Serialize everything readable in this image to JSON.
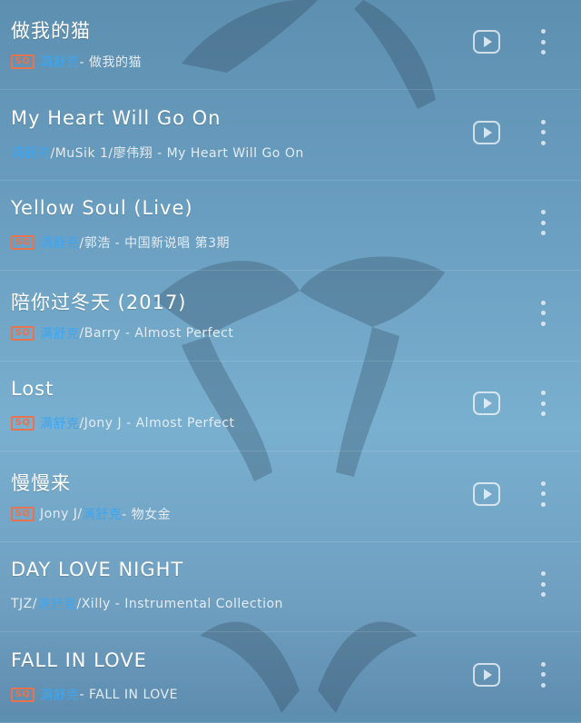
{
  "songs": [
    {
      "title": "做我的猫",
      "sq": true,
      "meta_prefix": "",
      "artist_hl": "满舒克",
      "meta_suffix": " - 做我的猫",
      "has_play": true
    },
    {
      "title": "My Heart Will Go On",
      "sq": false,
      "meta_prefix": "",
      "artist_hl": "满舒克",
      "meta_suffix": "/MuSik 1/廖伟翔 - My Heart Will Go On",
      "has_play": true
    },
    {
      "title": "Yellow Soul (Live)",
      "sq": true,
      "meta_prefix": "",
      "artist_hl": "满舒克",
      "meta_suffix": "/郭浩 - 中国新说唱 第3期",
      "has_play": false
    },
    {
      "title": "陪你过冬天 (2017)",
      "sq": true,
      "meta_prefix": "",
      "artist_hl": "满舒克",
      "meta_suffix": "/Barry - Almost Perfect",
      "has_play": false
    },
    {
      "title": "Lost",
      "sq": true,
      "meta_prefix": "",
      "artist_hl": "满舒克",
      "meta_suffix": "/Jony J - Almost Perfect",
      "has_play": true
    },
    {
      "title": "慢慢来",
      "sq": true,
      "meta_prefix": "Jony J/",
      "artist_hl": "满舒克",
      "meta_suffix": " - 物女金",
      "has_play": true
    },
    {
      "title": "DAY LOVE NIGHT",
      "sq": false,
      "meta_prefix": "TJZ/",
      "artist_hl": "满舒克",
      "meta_suffix": "/Xilly - Instrumental Collection",
      "has_play": false
    },
    {
      "title": "FALL IN LOVE",
      "sq": true,
      "meta_prefix": "",
      "artist_hl": "满舒克",
      "meta_suffix": " - FALL IN LOVE",
      "has_play": true
    }
  ],
  "sq_label": "SQ",
  "colors": {
    "accent": "#3ea6f0",
    "sq_badge": "#e8734e"
  }
}
